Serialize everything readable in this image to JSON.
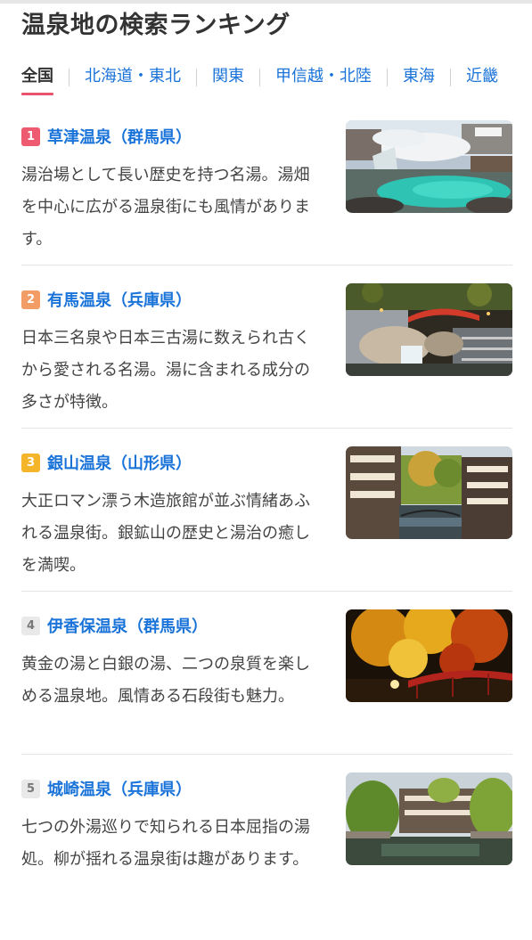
{
  "page": {
    "title": "温泉地の検索ランキング"
  },
  "tabs": [
    "全国",
    "北海道・東北",
    "関東",
    "甲信越・北陸",
    "東海",
    "近畿"
  ],
  "colors": {
    "link": "#1a73d9",
    "active_underline": "#e8546b"
  },
  "ranking": [
    {
      "rank": "1",
      "name": "草津温泉（群馬県）",
      "badge_color": "#ee5a6f",
      "image": "yubatake-hot-spring-photo",
      "desc": "湯治場として長い歴史を持つ名湯。湯畑を中心に広がる温泉街にも風情があります。"
    },
    {
      "rank": "2",
      "name": "有馬温泉（兵庫県）",
      "badge_color": "#f29d65",
      "image": "arima-bridge-waterfall-photo",
      "desc": "日本三名泉や日本三古湯に数えられ古くから愛される名湯。湯に含まれる成分の多さが特徴。"
    },
    {
      "rank": "3",
      "name": "銀山温泉（山形県）",
      "badge_color": "#f5b52a",
      "image": "ginzan-ryokan-street-photo",
      "desc": "大正ロマン漂う木造旅館が並ぶ情緒あふれる温泉街。銀鉱山の歴史と湯治の癒しを満喫。"
    },
    {
      "rank": "4",
      "name": "伊香保温泉（群馬県）",
      "badge_color": "#e9e9e9",
      "image": "ikaho-autumn-bridge-photo",
      "desc": "黄金の湯と白銀の湯、二つの泉質を楽しめる温泉地。風情ある石段街も魅力。"
    },
    {
      "rank": "5",
      "name": "城崎温泉（兵庫県）",
      "badge_color": "#e9e9e9",
      "image": "kinosaki-canal-willow-photo",
      "desc": "七つの外湯巡りで知られる日本屈指の湯処。柳が揺れる温泉街は趣があります。"
    }
  ]
}
